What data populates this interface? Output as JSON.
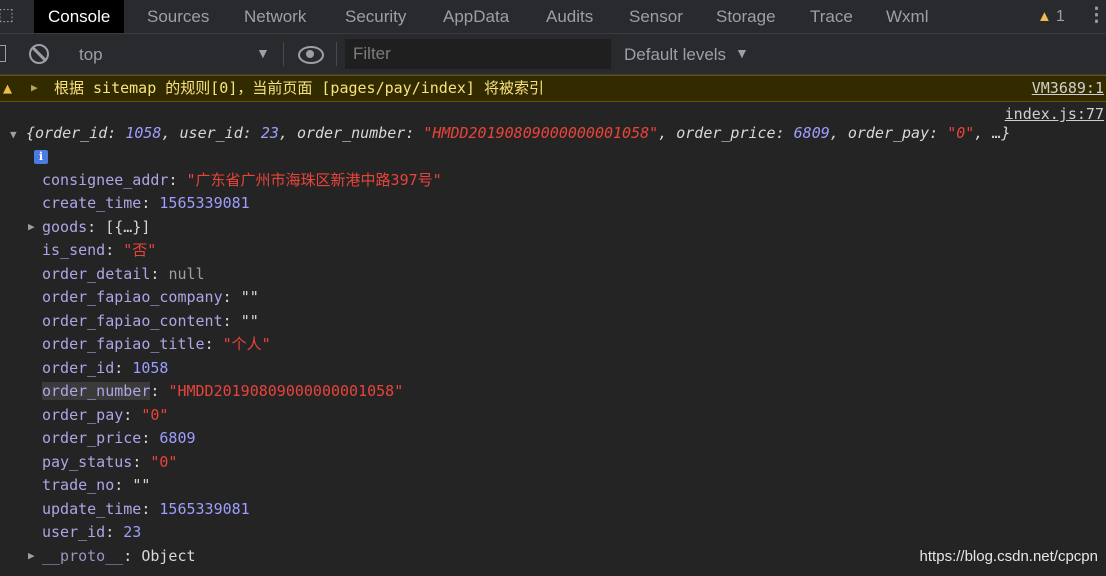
{
  "tabs": [
    {
      "label": "Console",
      "active": true
    },
    {
      "label": "Sources"
    },
    {
      "label": "Network"
    },
    {
      "label": "Security"
    },
    {
      "label": "AppData"
    },
    {
      "label": "Audits"
    },
    {
      "label": "Sensor"
    },
    {
      "label": "Storage"
    },
    {
      "label": "Trace"
    },
    {
      "label": "Wxml"
    }
  ],
  "warning_count": "1",
  "toolbar": {
    "context": "top",
    "filter_placeholder": "Filter",
    "levels": "Default levels"
  },
  "warning": {
    "text": "根据 sitemap 的规则[0]，当前页面 [pages/pay/index] 将被索引",
    "source": "VM3689:1"
  },
  "log": {
    "source": "index.js:77",
    "summary": {
      "open": "{",
      "order_id_key": "order_id",
      "order_id": "1058",
      "user_id_key": "user_id",
      "user_id": "23",
      "order_number_key": "order_number",
      "order_number": "\"HMDD20190809000000001058\"",
      "order_price_key": "order_price",
      "order_price": "6809",
      "order_pay_key": "order_pay",
      "order_pay": "\"0\"",
      "tail": ", …}"
    },
    "properties": [
      {
        "key": "consignee_addr",
        "value": "\"广东省广州市海珠区新港中路397号\"",
        "type": "strcn"
      },
      {
        "key": "create_time",
        "value": "1565339081",
        "type": "num"
      },
      {
        "key": "goods",
        "value": "[{…}]",
        "type": "plain",
        "expandable": true
      },
      {
        "key": "is_send",
        "value": "\"否\"",
        "type": "strcn"
      },
      {
        "key": "order_detail",
        "value": "null",
        "type": "nul"
      },
      {
        "key": "order_fapiao_company",
        "value": "\"\"",
        "type": "plain"
      },
      {
        "key": "order_fapiao_content",
        "value": "\"\"",
        "type": "plain"
      },
      {
        "key": "order_fapiao_title",
        "value": "\"个人\"",
        "type": "strcn"
      },
      {
        "key": "order_id",
        "value": "1058",
        "type": "num"
      },
      {
        "key": "order_number",
        "value": "\"HMDD20190809000000001058\"",
        "type": "strcn",
        "highlight": true
      },
      {
        "key": "order_pay",
        "value": "\"0\"",
        "type": "strcn"
      },
      {
        "key": "order_price",
        "value": "6809",
        "type": "num"
      },
      {
        "key": "pay_status",
        "value": "\"0\"",
        "type": "strcn"
      },
      {
        "key": "trade_no",
        "value": "\"\"",
        "type": "plain"
      },
      {
        "key": "update_time",
        "value": "1565339081",
        "type": "num"
      },
      {
        "key": "user_id",
        "value": "23",
        "type": "num"
      },
      {
        "key": "__proto__",
        "value": "Object",
        "type": "plain",
        "expandable": true,
        "proto": true
      }
    ]
  },
  "watermark": "https://blog.csdn.net/cpcpn"
}
